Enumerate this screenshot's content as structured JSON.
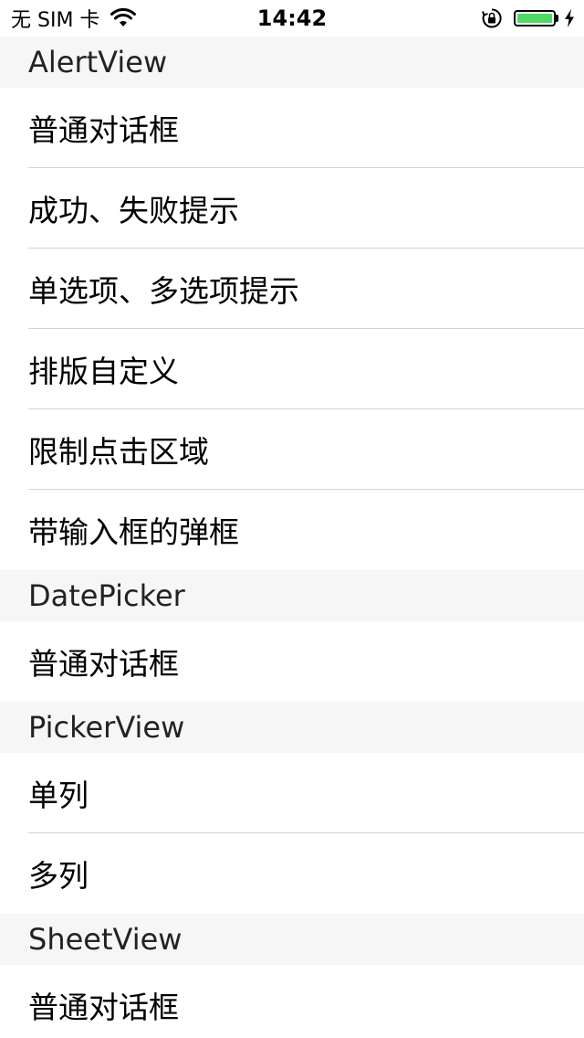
{
  "status_bar": {
    "carrier": "无 SIM 卡",
    "time": "14:42",
    "battery_level": 1.0,
    "battery_color": "#4cd964",
    "icons": [
      "wifi-icon",
      "rotation-lock-icon",
      "battery-icon",
      "charging-icon"
    ]
  },
  "sections": [
    {
      "header": "AlertView",
      "items": [
        "普通对话框",
        "成功、失败提示",
        "单选项、多选项提示",
        "排版自定义",
        "限制点击区域",
        "带输入框的弹框"
      ]
    },
    {
      "header": "DatePicker",
      "items": [
        "普通对话框"
      ]
    },
    {
      "header": "PickerView",
      "items": [
        "单列",
        "多列"
      ]
    },
    {
      "header": "SheetView",
      "items": [
        "普通对话框"
      ]
    }
  ]
}
